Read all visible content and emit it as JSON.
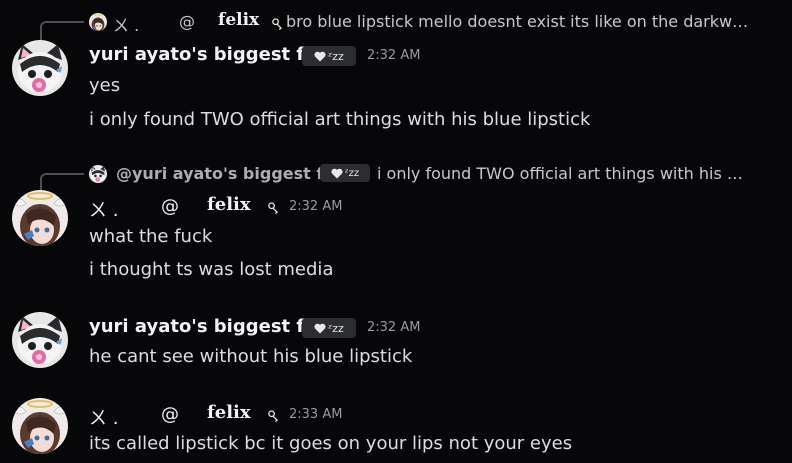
{
  "messages": [
    {
      "reply": {
        "user_symbols": "ㄨ .",
        "at": "@",
        "user": "felix",
        "icon": "pin-tag-icon",
        "text": "bro blue lipstick mello doesnt exist its like on the darkw…"
      },
      "author": "yuri ayato's biggest fan",
      "badge": "ᶻz𝗓",
      "time": "2:32 AM",
      "lines": [
        "yes",
        "i only found TWO official art things with his blue lipstick"
      ]
    },
    {
      "reply": {
        "user": "@yuri ayato's biggest fan",
        "badge": "ᶻz𝗓",
        "text": "i only found TWO official art things with his …"
      },
      "author_symbols": "ㄨ .",
      "at": "@",
      "author": "felix",
      "icon": "pin-tag-icon",
      "time": "2:32 AM",
      "lines": [
        "what the fuck",
        "i thought ts was lost media"
      ]
    },
    {
      "author": "yuri ayato's biggest fan",
      "badge": "ᶻz𝗓",
      "time": "2:32 AM",
      "lines": [
        "he cant see without his blue lipstick"
      ]
    },
    {
      "author_symbols": "ㄨ .",
      "at": "@",
      "author": "felix",
      "icon": "pin-tag-icon",
      "time": "2:33 AM",
      "lines": [
        "its called lipstick bc it goes on your lips not your eyes"
      ]
    }
  ],
  "colors": {
    "background": "#070709",
    "username": "#f2f3f5",
    "message_text": "#dbdee1",
    "timestamp": "#949ba4",
    "badge_bg": "#2b2d31"
  }
}
